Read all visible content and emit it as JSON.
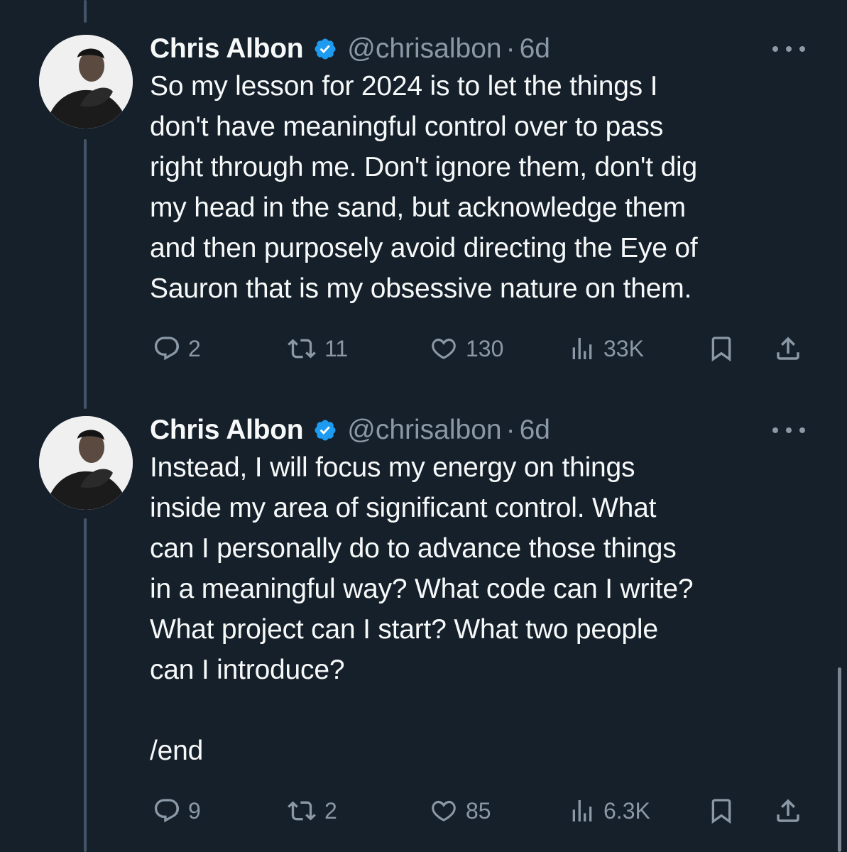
{
  "tweets": [
    {
      "author": {
        "name": "Chris Albon",
        "handle": "@chrisalbon",
        "time": "6d",
        "verified_icon": "verified-badge-icon"
      },
      "text": "So my lesson for 2024 is to let the things I\ndon't have meaningful control over to pass\nright through me. Don't ignore them, don't dig\nmy head in the sand, but acknowledge them\nand then purposely avoid directing the Eye of\nSauron that is my obsessive nature on them.",
      "stats": {
        "replies": "2",
        "reposts": "11",
        "likes": "130",
        "views": "33K"
      }
    },
    {
      "author": {
        "name": "Chris Albon",
        "handle": "@chrisalbon",
        "time": "6d",
        "verified_icon": "verified-badge-icon"
      },
      "text": "Instead, I will focus my energy on things\ninside my area of significant control. What\ncan I personally do to advance those things\nin a meaningful way? What code can I write?\nWhat project can I start? What two people\ncan I introduce?\n\n/end",
      "stats": {
        "replies": "9",
        "reposts": "2",
        "likes": "85",
        "views": "6.3K"
      }
    }
  ],
  "separator": "·",
  "colors": {
    "background": "#15202b",
    "text": "#f7f9f9",
    "muted": "#8b98a5",
    "verified": "#1d9bf0",
    "thread_line": "#425466"
  },
  "icons": [
    "reply-icon",
    "repost-icon",
    "like-icon",
    "views-icon",
    "bookmark-icon",
    "share-icon",
    "more-icon"
  ]
}
